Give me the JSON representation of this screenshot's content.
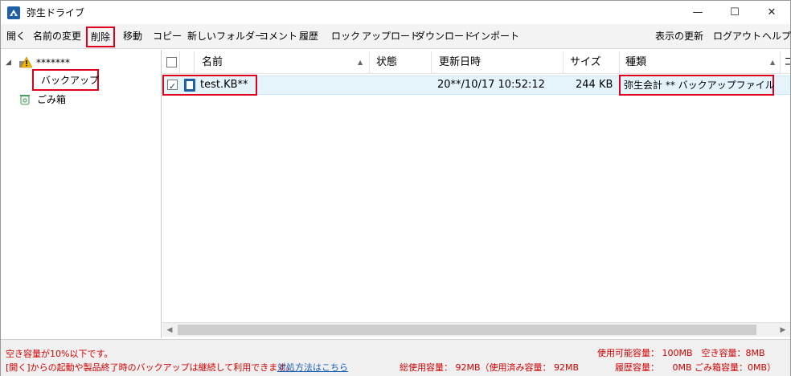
{
  "window": {
    "title": "弥生ドライブ",
    "controls": {
      "minimize": "—",
      "maximize": "☐",
      "close": "✕"
    }
  },
  "toolbar": {
    "open": "開く",
    "rename": "名前の変更",
    "delete": "削除",
    "move": "移動",
    "copy": "コピー",
    "new_folder": "新しいフォルダー",
    "comment": "コメント",
    "history": "履歴",
    "lock": "ロック",
    "upload": "アップロード",
    "download": "ダウンロード",
    "import": "インポート",
    "refresh": "表示の更新",
    "logout": "ログアウト",
    "help": "ヘルプ"
  },
  "tree": {
    "root_label": "*******",
    "backup_label": "バックアップ",
    "trash_label": "ごみ箱"
  },
  "list": {
    "columns": {
      "name": "名前",
      "status": "状態",
      "updated": "更新日時",
      "size": "サイズ",
      "type": "種類",
      "extra": "コ"
    },
    "rows": [
      {
        "name": "test.KB**",
        "status": "",
        "updated": "20**/10/17 10:52:12",
        "size": "244 KB",
        "type": "弥生会計 ** バックアップファイル"
      }
    ]
  },
  "status": {
    "warning": "空き容量が10%以下です。",
    "notice": "[開く]からの起動や製品終了時のバックアップは継続して利用できます。",
    "link": "対処方法はこちら",
    "usable": "使用可能容量： 100MB　空き容量：8MB",
    "total": "総使用容量： 92MB（使用済み容量： 92MB",
    "history_cap": "履歴容量：　　0MB ごみ箱容量：0MB）"
  },
  "colors": {
    "highlight": "#e0001b",
    "selection": "#e5f3fb",
    "warning": "#d40000",
    "link": "#1a5fb4"
  }
}
